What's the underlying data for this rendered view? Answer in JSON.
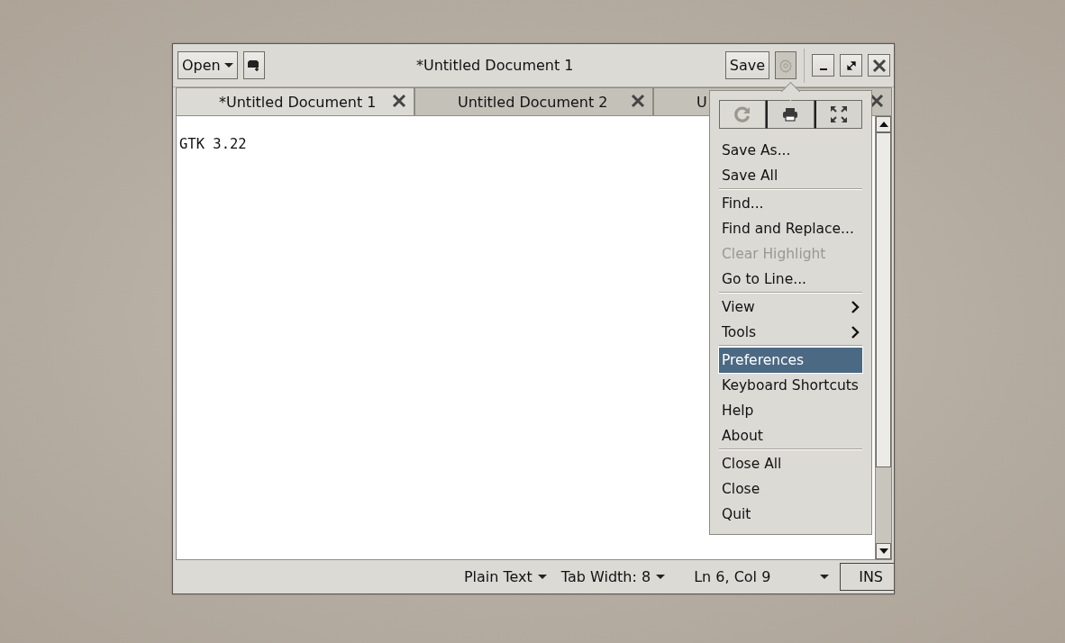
{
  "window": {
    "title": "*Untitled Document 1"
  },
  "header": {
    "open_button": "Open",
    "save_button": "Save",
    "menu_button": {
      "pressed": true
    }
  },
  "tabs": [
    {
      "label": "*Untitled Document 1",
      "selected": true
    },
    {
      "label": "Untitled Document 2",
      "selected": false
    },
    {
      "label": "U",
      "selected": false
    }
  ],
  "editor": {
    "text": "GTK 3.22"
  },
  "menu": {
    "toolbar": [
      {
        "kind": "reload",
        "disabled": true
      },
      {
        "kind": "print",
        "disabled": false
      },
      {
        "kind": "fullscreen",
        "disabled": false
      }
    ],
    "items": [
      {
        "kind": "item",
        "label": "Save As...",
        "disabled": false,
        "selected": false
      },
      {
        "kind": "item",
        "label": "Save All",
        "disabled": false,
        "selected": false
      },
      {
        "kind": "separator"
      },
      {
        "kind": "item",
        "label": "Find...",
        "disabled": false,
        "selected": false
      },
      {
        "kind": "item",
        "label": "Find and Replace...",
        "disabled": false,
        "selected": false
      },
      {
        "kind": "item",
        "label": "Clear Highlight",
        "disabled": true,
        "selected": false
      },
      {
        "kind": "item",
        "label": "Go to Line...",
        "disabled": false,
        "selected": false
      },
      {
        "kind": "separator"
      },
      {
        "kind": "submenu",
        "label": "View",
        "disabled": false,
        "selected": false
      },
      {
        "kind": "submenu",
        "label": "Tools",
        "disabled": false,
        "selected": false
      },
      {
        "kind": "separator"
      },
      {
        "kind": "item",
        "label": "Preferences",
        "disabled": false,
        "selected": true
      },
      {
        "kind": "item",
        "label": "Keyboard Shortcuts",
        "disabled": false,
        "selected": false
      },
      {
        "kind": "item",
        "label": "Help",
        "disabled": false,
        "selected": false
      },
      {
        "kind": "item",
        "label": "About",
        "disabled": false,
        "selected": false
      },
      {
        "kind": "separator"
      },
      {
        "kind": "item",
        "label": "Close All",
        "disabled": false,
        "selected": false
      },
      {
        "kind": "item",
        "label": "Close",
        "disabled": false,
        "selected": false
      },
      {
        "kind": "item",
        "label": "Quit",
        "disabled": false,
        "selected": false
      }
    ]
  },
  "status_bar": {
    "language": "Plain Text",
    "tab_width": "Tab Width: 8",
    "position": "Ln 6, Col 9",
    "mode": "INS"
  }
}
